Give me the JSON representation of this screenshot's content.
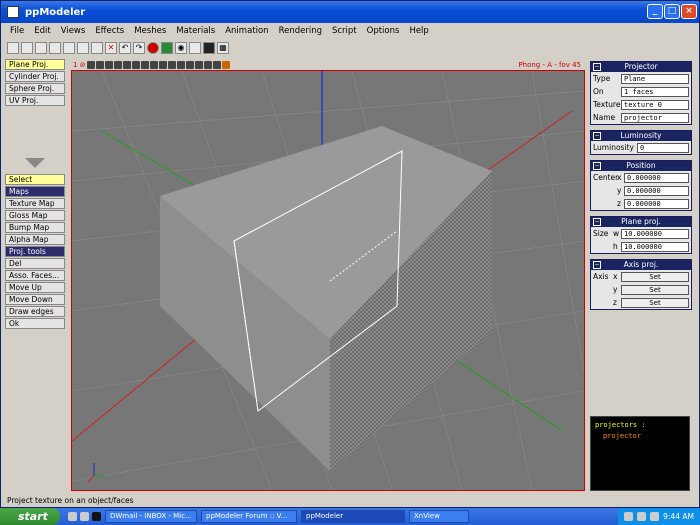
{
  "window": {
    "title": "ppModeler"
  },
  "menu": [
    "File",
    "Edit",
    "Views",
    "Effects",
    "Meshes",
    "Materials",
    "Animation",
    "Rendering",
    "Script",
    "Options",
    "Help"
  ],
  "viewport": {
    "label": "Phong - A - fov 45"
  },
  "left": {
    "proj_buttons": [
      "Plane Proj.",
      "Cylinder Proj.",
      "Sphere Proj.",
      "UV Proj."
    ],
    "tools": [
      "Select",
      "Maps",
      "Texture Map",
      "Gloss Map",
      "Bump Map",
      "Alpha Map",
      "Proj. tools",
      "Del",
      "Asso. Faces...",
      "Move Up",
      "Move Down",
      "Draw edges",
      "Ok"
    ]
  },
  "projector": {
    "title": "Projector",
    "type_label": "Type",
    "type": "Plane",
    "on_label": "On",
    "on": "1 faces",
    "texture_label": "Texture",
    "texture": "texture 0",
    "name_label": "Name",
    "name": "projector"
  },
  "luminosity": {
    "title": "Luminosity",
    "label": "Luminosity",
    "value": "0"
  },
  "position": {
    "title": "Position",
    "center_label": "Center",
    "x_label": "x",
    "x": "0.000000",
    "y_label": "y",
    "y": "0.000000",
    "z_label": "z",
    "z": "0.000000"
  },
  "plane_proj": {
    "title": "Plane proj.",
    "size_label": "Size",
    "w_label": "w",
    "w": "10.000000",
    "h_label": "h",
    "h": "10.000000"
  },
  "axis_proj": {
    "title": "Axis proj.",
    "axis_label": "Axis",
    "x_label": "x",
    "y_label": "y",
    "z_label": "z",
    "set": "Set"
  },
  "console": {
    "line1": "projectors :",
    "line2": "projector"
  },
  "status": "Project texture on an object/faces",
  "taskbar": {
    "start": "start",
    "tasks": [
      "DWmail - INBOX - Mic...",
      "ppModeler Forum :: V...",
      "ppModeler",
      "XnView"
    ],
    "time": "9:44 AM"
  },
  "colors": {
    "viewport_border": "#cc0000",
    "panel_head": "#1a2460",
    "selected": "#2c2c6c"
  }
}
